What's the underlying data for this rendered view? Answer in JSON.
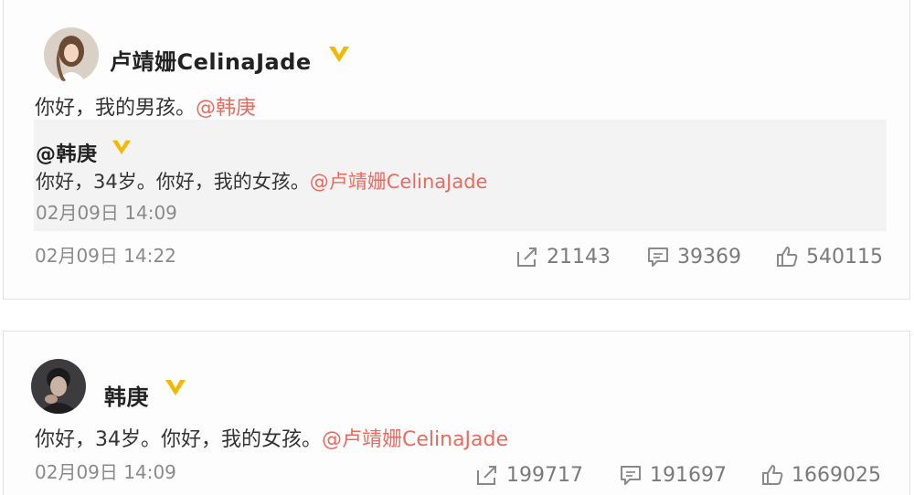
{
  "post1": {
    "author": "卢靖姗CelinaJade",
    "text_before": "你好，我的男孩。",
    "mention": "@韩庚",
    "time": "02月09日 14:22",
    "repost": {
      "author": "@韩庚",
      "text_before": "你好，34岁。你好，我的女孩。",
      "mention": "@卢靖姗CelinaJade",
      "time": "02月09日 14:09"
    },
    "stats": {
      "share": "21143",
      "comment": "39369",
      "like": "540115"
    }
  },
  "post2": {
    "author": "韩庚",
    "text_before": "你好，34岁。你好，我的女孩。",
    "mention": "@卢靖姗CelinaJade",
    "time": "02月09日 14:09",
    "stats": {
      "share": "199717",
      "comment": "191697",
      "like": "1669025"
    }
  },
  "colors": {
    "mention": "#eb6a5e",
    "verified_badge": "#f5b800",
    "stat_text": "#7a7a7a"
  },
  "icons": [
    "verified-v-icon",
    "share-icon",
    "comment-icon",
    "like-icon"
  ]
}
